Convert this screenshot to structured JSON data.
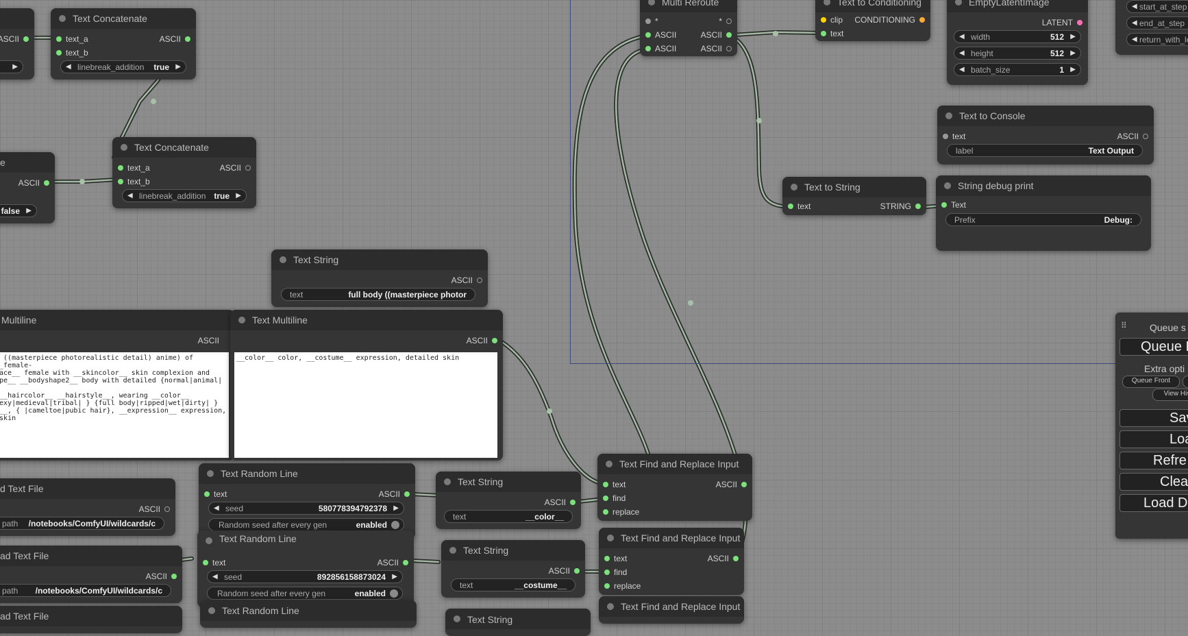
{
  "nodes": {
    "concat1": {
      "title": "Text Concatenate",
      "in_a": "text_a",
      "in_b": "text_b",
      "out": "ASCII",
      "w_label": "linebreak_addition",
      "w_value": "true"
    },
    "concat2": {
      "title": "Text Concatenate",
      "in_a": "text_a",
      "in_b": "text_b",
      "out": "ASCII",
      "w_label": "linebreak_addition",
      "w_value": "true"
    },
    "left_top": {
      "out": "ASCII"
    },
    "left_mid": {
      "title": "e",
      "out": "ASCII",
      "w_value": "false"
    },
    "multi_reroute": {
      "title": "Multi Reroute",
      "in1": "*",
      "out1": "*",
      "in2": "ASCII",
      "out2": "ASCII",
      "in3": "ASCII",
      "out3": "ASCII"
    },
    "text_to_cond": {
      "title": "Text to Conditioning",
      "in_clip": "clip",
      "in_text": "text",
      "out": "CONDITIONING"
    },
    "empty_latent": {
      "title": "EmptyLatentImage",
      "out": "LATENT",
      "widgets": [
        {
          "label": "width",
          "value": "512"
        },
        {
          "label": "height",
          "value": "512"
        },
        {
          "label": "batch_size",
          "value": "1"
        }
      ]
    },
    "right_partial": {
      "widgets": [
        "start_at_step",
        "end_at_step",
        "return_with_le"
      ]
    },
    "text_to_console": {
      "title": "Text to Console",
      "in": "text",
      "out": "ASCII",
      "w_label": "label",
      "w_value": "Text Output"
    },
    "text_to_string": {
      "title": "Text to String",
      "in": "text",
      "out": "STRING"
    },
    "string_debug": {
      "title": "String debug print",
      "in": "Text",
      "w_label": "Prefix",
      "w_value": "Debug:"
    },
    "text_string1": {
      "title": "Text String",
      "out": "ASCII",
      "w_label": "text",
      "w_value": "full body ((masterpiece photor"
    },
    "multiline_left": {
      "title": "Multiline",
      "out": "ASCII",
      "text": "y ((masterpiece photorealistic detail) anime) of __female-\nrace__ female with __skincolor__ skin complexion and\nape__ __bodyshape2__ body with detailed {normal|animal| }\n __haircolor__ __hairstyle__, wearing __color__\nsexy|medieval|tribal| } {full body|ripped|wet|dirty| }\ne__, { |cameltoe|pubic hair}, __expression__ expression,\n skin"
    },
    "multiline_right": {
      "title": "Text Multiline",
      "out": "ASCII",
      "text": "__color__ color, __costume__ expression, detailed skin"
    },
    "load_file1": {
      "title": "d Text File",
      "out": "ASCII",
      "w_label": "path",
      "w_value": "/notebooks/ComfyUI/wildcards/c"
    },
    "load_file2": {
      "title": "ad Text File",
      "out": "ASCII",
      "w_label": "path",
      "w_value": "/notebooks/ComfyUI/wildcards/c"
    },
    "load_file3": {
      "title": "ad Text File"
    },
    "random_line1": {
      "title": "Text Random Line",
      "in": "text",
      "out": "ASCII",
      "seed_label": "seed",
      "seed_value": "580778394792378",
      "toggle_label": "Random seed after every gen",
      "toggle_value": "enabled"
    },
    "random_line2": {
      "title": "Text Random Line",
      "in": "text",
      "out": "ASCII",
      "seed_label": "seed",
      "seed_value": "892856158873024",
      "toggle_label": "Random seed after every gen",
      "toggle_value": "enabled"
    },
    "random_line3": {
      "title": "Text Random Line"
    },
    "text_string2": {
      "title": "Text String",
      "out": "ASCII",
      "w_label": "text",
      "w_value": "__color__"
    },
    "text_string3": {
      "title": "Text String",
      "out": "ASCII",
      "w_label": "text",
      "w_value": "__costume__"
    },
    "text_string4": {
      "title": "Text String"
    },
    "find_replace1": {
      "title": "Text Find and Replace Input",
      "in_text": "text",
      "in_find": "find",
      "in_replace": "replace",
      "out": "ASCII"
    },
    "find_replace2": {
      "title": "Text Find and Replace Input",
      "in_text": "text",
      "in_find": "find",
      "in_replace": "replace",
      "out": "ASCII"
    },
    "find_replace3": {
      "title": "Text Find and Replace Input"
    }
  },
  "queue_panel": {
    "title": "Queue s",
    "queue_button": "Queue P",
    "extra_options": "Extra opti",
    "queue_front": "Queue Front",
    "view_history": "View His",
    "save": "Sav",
    "load": "Loa",
    "refresh": "Refre",
    "clear": "Clea",
    "load_default": "Load D"
  }
}
